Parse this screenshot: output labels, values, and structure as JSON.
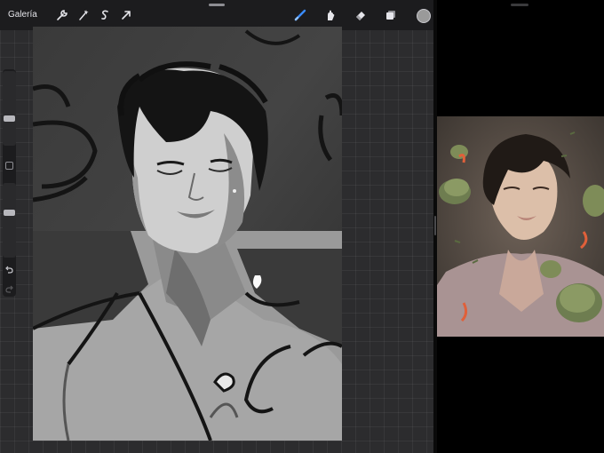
{
  "app": {
    "gallery_label": "Galería"
  },
  "toolbar_left": [
    {
      "name": "wrench-icon",
      "label": "actions"
    },
    {
      "name": "magic-wand-icon",
      "label": "adjustments"
    },
    {
      "name": "selection-s-icon",
      "label": "selection"
    },
    {
      "name": "arrow-cursor-icon",
      "label": "transform"
    }
  ],
  "toolbar_right": [
    {
      "name": "brush-icon",
      "label": "paint",
      "active": true
    },
    {
      "name": "smudge-icon",
      "label": "smudge"
    },
    {
      "name": "eraser-icon",
      "label": "erase"
    },
    {
      "name": "layers-icon",
      "label": "layers"
    }
  ],
  "current_color": "#9a9a9a",
  "accent_color": "#3a8cff",
  "sidebar": {
    "brush_size": 0.33,
    "brush_opacity": 0.4
  }
}
